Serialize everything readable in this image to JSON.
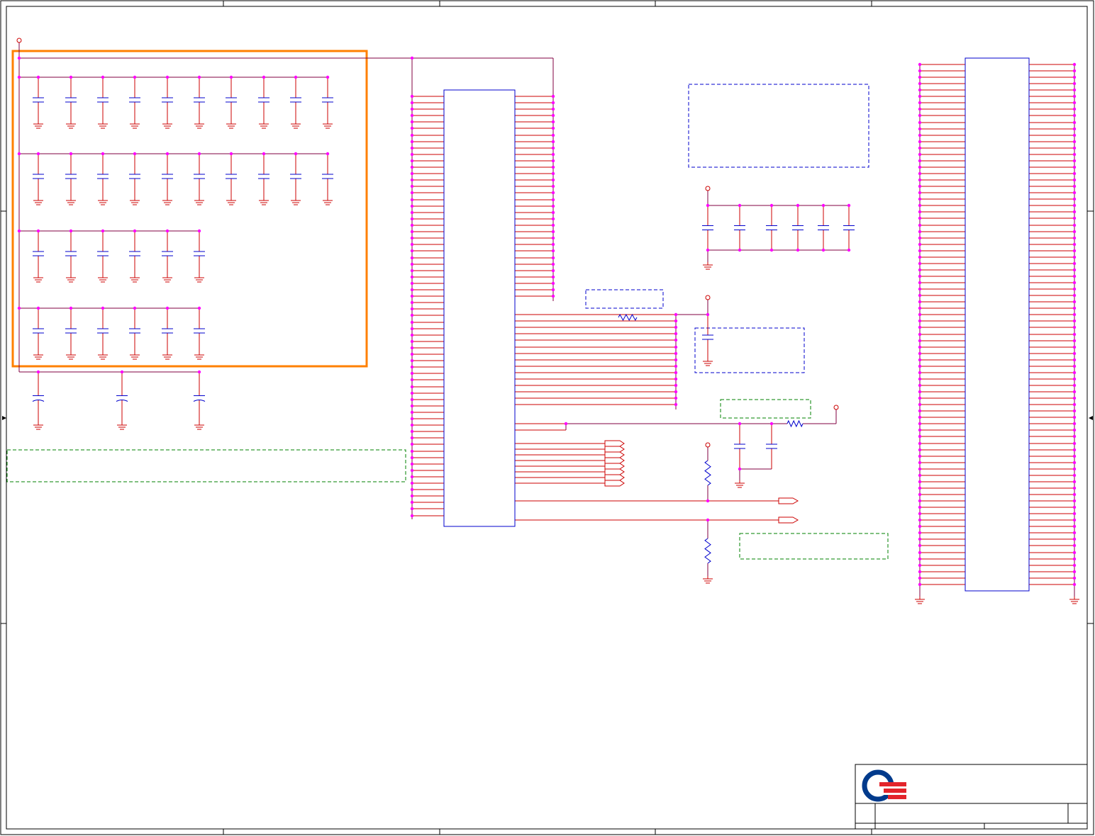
{
  "colors": {
    "frame": "#000000",
    "wire": "#800040",
    "pin": "#cc0000",
    "junction": "#ff00ff",
    "component": "#0000cc",
    "highlight": "#ff8000",
    "note_blue": "#0000cc",
    "note_green": "#008000",
    "ground": "#cc0000",
    "logo_blue": "#003a8c",
    "logo_red": "#e3242b"
  },
  "icons": {
    "logo": "company-logo-icon",
    "ground": "ground-symbol-icon",
    "capacitor": "capacitor-icon",
    "resistor": "resistor-icon",
    "power_port": "power-port-icon",
    "off_page": "off-page-connector-icon"
  },
  "title_block": {
    "logo": "Q",
    "fields": [
      "",
      "",
      "",
      ""
    ]
  }
}
